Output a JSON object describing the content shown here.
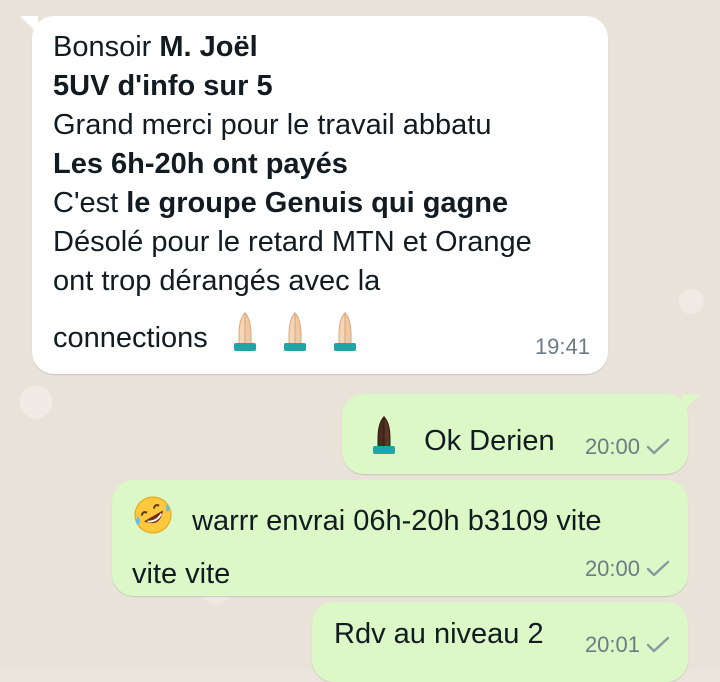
{
  "messages": {
    "m1": {
      "line1_plain": "Bonsoir ",
      "line1_bold": "M. Joël",
      "line2": "5UV d'info sur 5",
      "line3": "Grand merci pour le travail abbatu",
      "line4": "Les 6h-20h ont payés",
      "line5_plain": "C'est ",
      "line5_bold": "le groupe Genuis qui gagne",
      "line6": "Désolé pour le retard MTN et Orange",
      "line7": "ont trop dérangés avec la",
      "line8": "connections",
      "emojis": [
        "folded-hands",
        "folded-hands",
        "folded-hands"
      ],
      "time": "19:41"
    },
    "m2": {
      "emoji": "folded-hands-dark",
      "text": "Ok Derien",
      "time": "20:00",
      "status": "sent-check"
    },
    "m3": {
      "emoji": "rolling-laughing-face",
      "line1": "warrr envrai 06h-20h b3109 vite",
      "line2": "vite vite",
      "time": "20:00",
      "status": "sent-check"
    },
    "m4": {
      "text": "Rdv au niveau 2",
      "time": "20:01",
      "status": "sent-check"
    }
  },
  "colors": {
    "background": "#ece5dd",
    "incoming_bubble": "#ffffff",
    "outgoing_bubble": "#dcf8c6",
    "timestamp": "#6b7c85"
  }
}
